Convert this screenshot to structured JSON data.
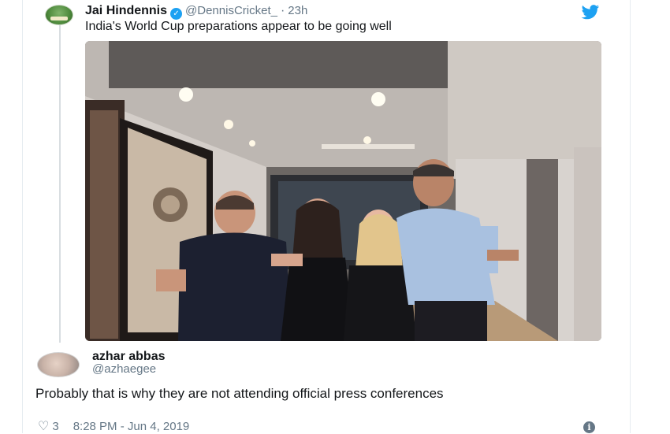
{
  "quoted_tweet": {
    "name": "Jai Hindennis",
    "handle": "@DennisCricket_",
    "separator": "·",
    "time": "23h",
    "text": "India's World Cup preparations appear to be going well",
    "icons": {
      "avatar": "avatar-icon",
      "verified": "verified-badge-icon",
      "bird": "twitter-bird-icon"
    }
  },
  "reply_tweet": {
    "name": "azhar abbas",
    "handle": "@azhaegee",
    "text": "Probably that is why they are not attending official press conferences",
    "likes": "3",
    "timestamp": "8:28 PM - Jun 4, 2019",
    "icons": {
      "like": "heart-icon",
      "info": "info-icon"
    }
  },
  "colors": {
    "accent": "#1da1f2",
    "text": "#14171a",
    "muted": "#657786",
    "border": "#e6ecf0"
  }
}
